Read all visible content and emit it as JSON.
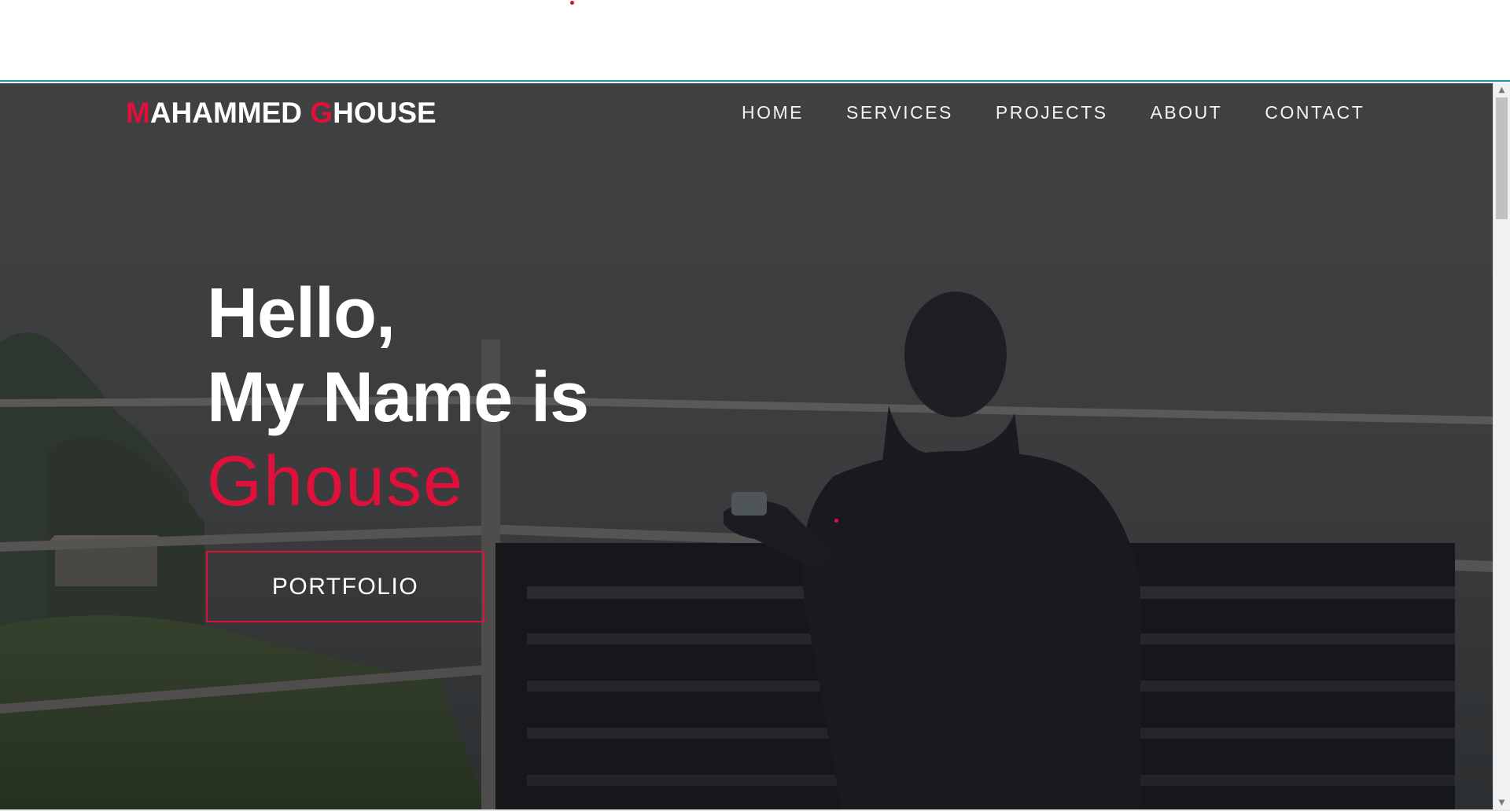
{
  "brand": {
    "first_initial": "M",
    "first_rest": "AHAMMED ",
    "last_initial": "G",
    "last_rest": "HOUSE",
    "accent_color": "#e0103a"
  },
  "nav": {
    "items": [
      {
        "label": "HOME"
      },
      {
        "label": "SERVICES"
      },
      {
        "label": "PROJECTS"
      },
      {
        "label": "ABOUT"
      },
      {
        "label": "CONTACT"
      }
    ]
  },
  "hero": {
    "line1": "Hello,",
    "line2": "My Name is",
    "name": "Ghouse",
    "button_label": "PORTFOLIO",
    "background_image": "person-on-bench-icon"
  },
  "scrollbar": {
    "up_icon": "triangle-up-icon",
    "down_icon": "triangle-down-icon"
  }
}
